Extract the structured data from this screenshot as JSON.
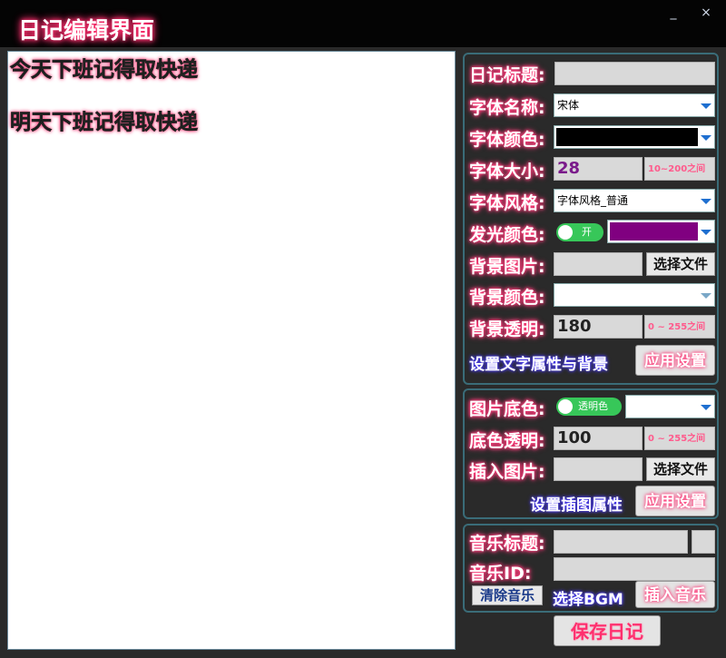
{
  "window": {
    "title": "日记编辑界面",
    "minimize_glyph": "_",
    "close_glyph": "×"
  },
  "editor": {
    "lines": [
      "今天下班记得取快递",
      "明天下班记得取快递"
    ]
  },
  "text_panel": {
    "diary_title_label": "日记标题:",
    "diary_title_value": "",
    "font_name_label": "字体名称:",
    "font_name_value": "宋体",
    "font_color_label": "字体颜色:",
    "font_color_value": "#000000",
    "font_size_label": "字体大小:",
    "font_size_value": "28",
    "font_size_hint": "10~200之间",
    "font_style_label": "字体风格:",
    "font_style_value": "字体风格_普通",
    "glow_color_label": "发光颜色:",
    "glow_toggle_text": "开",
    "glow_color_value": "#800080",
    "bg_image_label": "背景图片:",
    "bg_image_value": "",
    "choose_file_label": "选择文件",
    "bg_color_label": "背景颜色:",
    "bg_color_value": "#ffffff",
    "bg_opacity_label": "背景透明:",
    "bg_opacity_value": "180",
    "bg_opacity_hint": "0 ~ 255之间",
    "section_label": "设置文字属性与背景",
    "apply_label": "应用设置"
  },
  "image_panel": {
    "base_color_label": "图片底色:",
    "toggle_text": "透明色",
    "base_color_value": "#ffffff",
    "base_opacity_label": "底色透明:",
    "base_opacity_value": "100",
    "base_opacity_hint": "0 ~ 255之间",
    "insert_image_label": "插入图片:",
    "insert_image_value": "",
    "choose_file_label": "选择文件",
    "section_label": "设置插图属性",
    "apply_label": "应用设置"
  },
  "music_panel": {
    "music_title_label": "音乐标题:",
    "music_id_label": "音乐ID:",
    "clear_music_label": "清除音乐",
    "choose_bgm_label": "选择BGM",
    "insert_music_label": "插入音乐"
  },
  "save_label": "保存日记"
}
